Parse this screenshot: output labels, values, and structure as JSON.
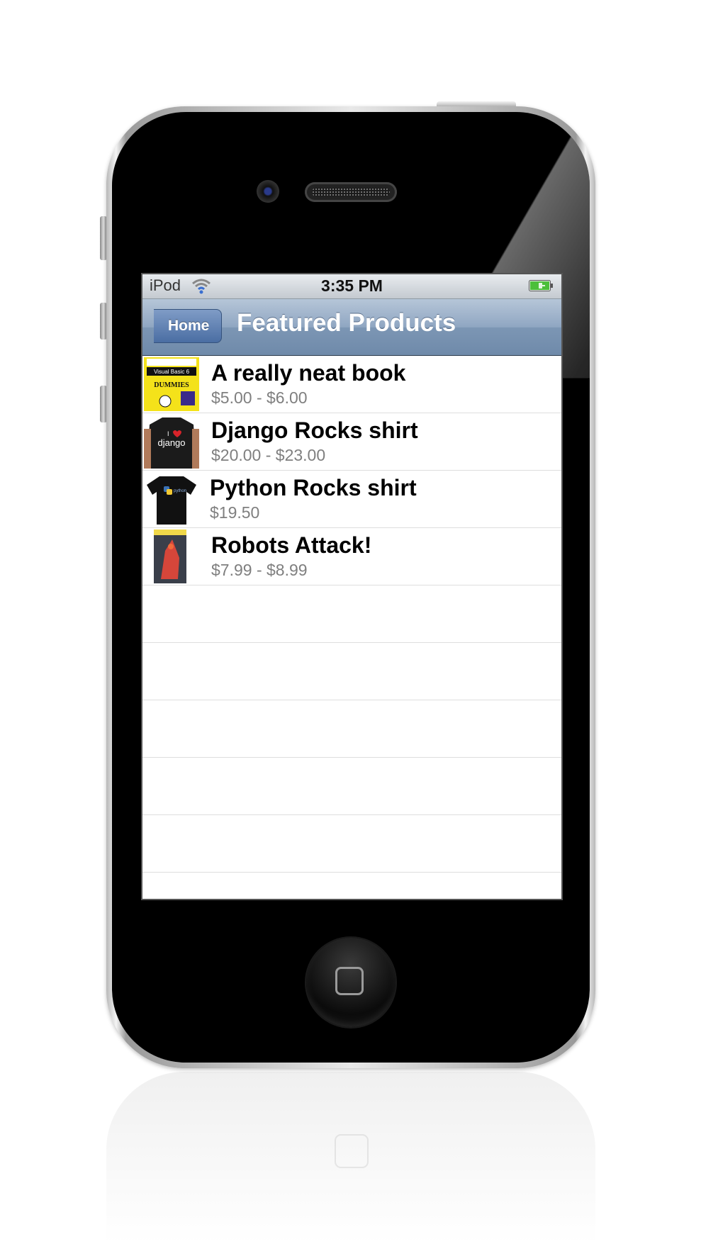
{
  "status_bar": {
    "carrier": "iPod",
    "time": "3:35 PM",
    "wifi_icon": "wifi-icon",
    "battery_icon": "battery-charging-icon"
  },
  "nav_bar": {
    "back_label": "Home",
    "title": "Featured Products"
  },
  "products": [
    {
      "title": "A really neat book",
      "price": "$5.00 - $6.00",
      "thumb": "book-dummies-thumbnail",
      "thumb_text": [
        "Visual Basic 6",
        "DUMMIES"
      ]
    },
    {
      "title": "Django Rocks shirt",
      "price": "$20.00 - $23.00",
      "thumb": "django-shirt-thumbnail",
      "thumb_text": [
        "I",
        "django"
      ]
    },
    {
      "title": "Python Rocks shirt",
      "price": "$19.50",
      "thumb": "python-shirt-thumbnail",
      "thumb_text": [
        "python"
      ]
    },
    {
      "title": "Robots Attack!",
      "price": "$7.99 - $8.99",
      "thumb": "robots-book-thumbnail",
      "thumb_text": []
    }
  ],
  "empty_rows": 6,
  "colors": {
    "nav_bar": "#8fa6c2",
    "back_button": "#4a6ea3",
    "price_text": "#7f7f7f",
    "separator": "#dedede"
  }
}
